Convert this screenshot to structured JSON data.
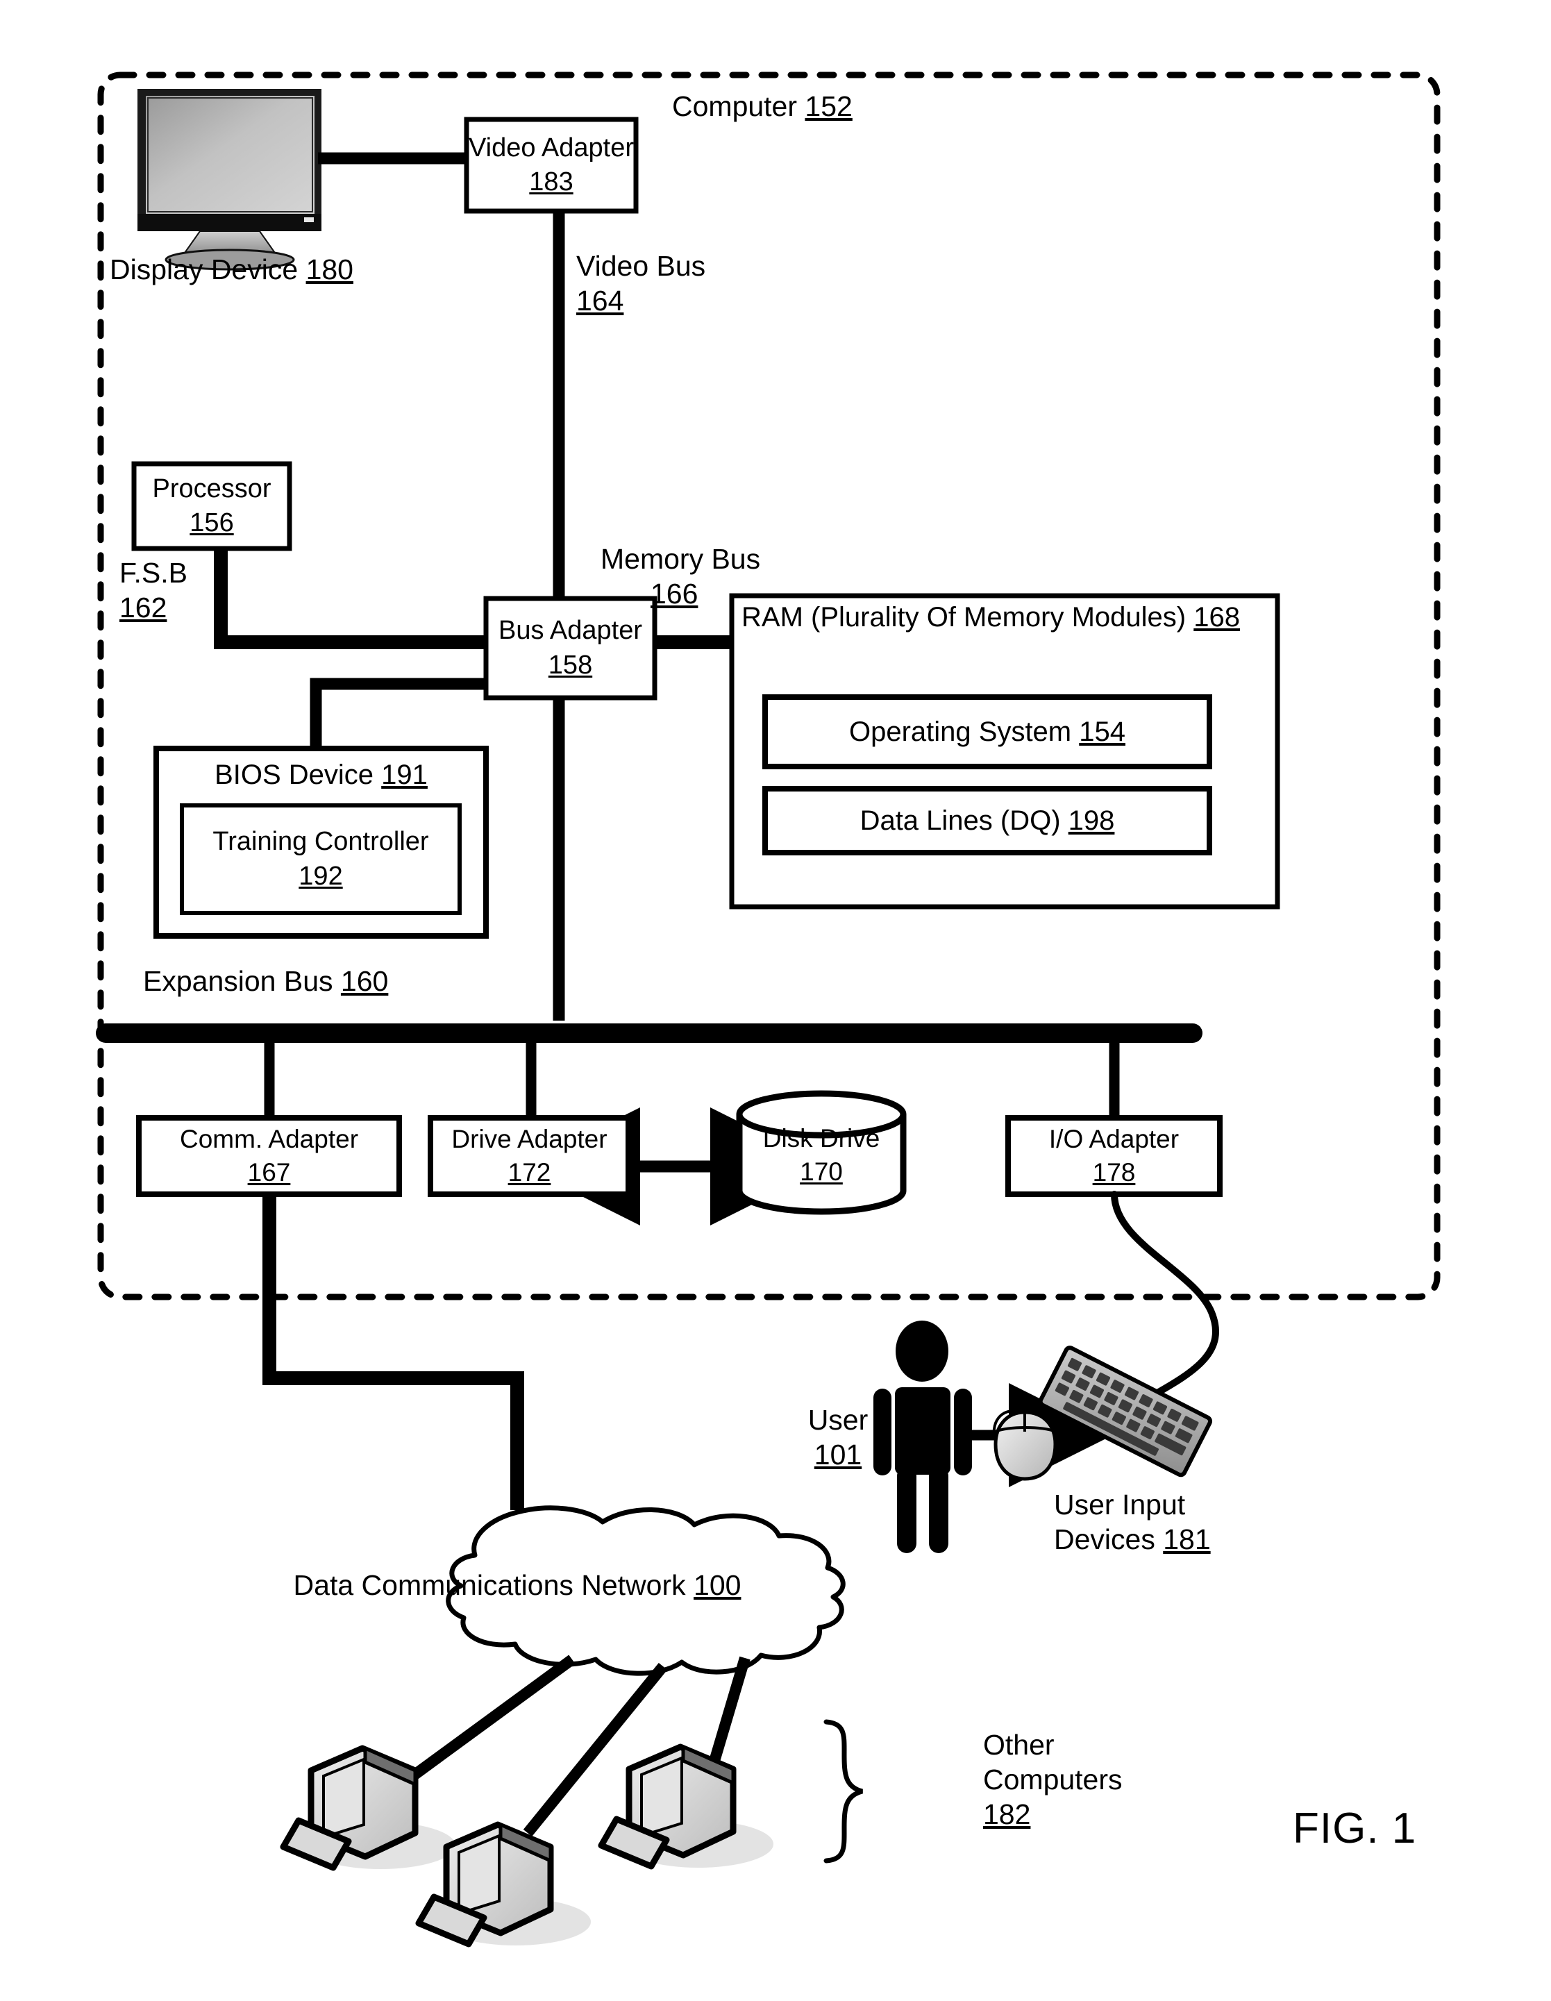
{
  "figure": {
    "label": "FIG. 1",
    "title": "Computer block diagram"
  },
  "computer_enclosure": {
    "name": "Computer",
    "ref": "152",
    "label": "Computer 152"
  },
  "blocks": {
    "display_device": {
      "name": "Display Device",
      "ref": "180"
    },
    "video_adapter": {
      "name": "Video Adapter",
      "ref": "183"
    },
    "video_bus": {
      "name": "Video Bus",
      "ref": "164"
    },
    "processor": {
      "name": "Processor",
      "ref": "156"
    },
    "fsb": {
      "name": "F.S.B",
      "ref": "162"
    },
    "bus_adapter": {
      "name": "Bus Adapter",
      "ref": "158"
    },
    "memory_bus": {
      "name": "Memory Bus",
      "ref": "166"
    },
    "ram": {
      "name": "RAM (Plurality Of Memory Modules)",
      "ref": "168"
    },
    "operating_system": {
      "name": "Operating System",
      "ref": "154"
    },
    "data_lines": {
      "name": "Data Lines (DQ)",
      "ref": "198"
    },
    "bios_device": {
      "name": "BIOS Device",
      "ref": "191"
    },
    "training_controller": {
      "name": "Training Controller",
      "ref": "192"
    },
    "expansion_bus": {
      "name": "Expansion Bus",
      "ref": "160"
    },
    "comm_adapter": {
      "name": "Comm. Adapter",
      "ref": "167"
    },
    "drive_adapter": {
      "name": "Drive Adapter",
      "ref": "172"
    },
    "disk_drive": {
      "name": "Disk Drive",
      "ref": "170"
    },
    "io_adapter": {
      "name": "I/O Adapter",
      "ref": "178"
    },
    "user": {
      "name": "User",
      "ref": "101"
    },
    "user_input_devices": {
      "name_line1": "User Input",
      "name_line2": "Devices",
      "ref": "181"
    },
    "network": {
      "name": "Data Communications Network",
      "ref": "100"
    },
    "other_computers": {
      "name_line1": "Other",
      "name_line2": "Computers",
      "ref": "182"
    }
  },
  "colors": {
    "ink": "#000000",
    "paper": "#ffffff",
    "screen_fill": "#b9b9b9",
    "device_fill": "#d8d8d8"
  }
}
